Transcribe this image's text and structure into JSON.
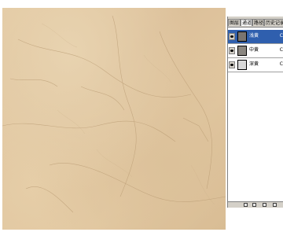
{
  "panel": {
    "tabs": [
      {
        "label": "图层",
        "active": false
      },
      {
        "label": "通道",
        "active": true
      },
      {
        "label": "路径",
        "active": false
      },
      {
        "label": "历史记录",
        "active": false
      }
    ],
    "layers": [
      {
        "name": "浅黄",
        "suffix": "C",
        "selected": true,
        "thumb_color": "#7a7570"
      },
      {
        "name": "中黄",
        "suffix": "C",
        "selected": false,
        "thumb_color": "#8a8680"
      },
      {
        "name": "深黄",
        "suffix": "C",
        "selected": false,
        "thumb_color": "#d8d8d8"
      }
    ]
  },
  "colors": {
    "selection": "#2f5fae",
    "panel_bg": "#d4d0c8",
    "marble_base": "#e3c9a2"
  },
  "icons": [
    "eye-icon",
    "panel-footer-icons"
  ]
}
